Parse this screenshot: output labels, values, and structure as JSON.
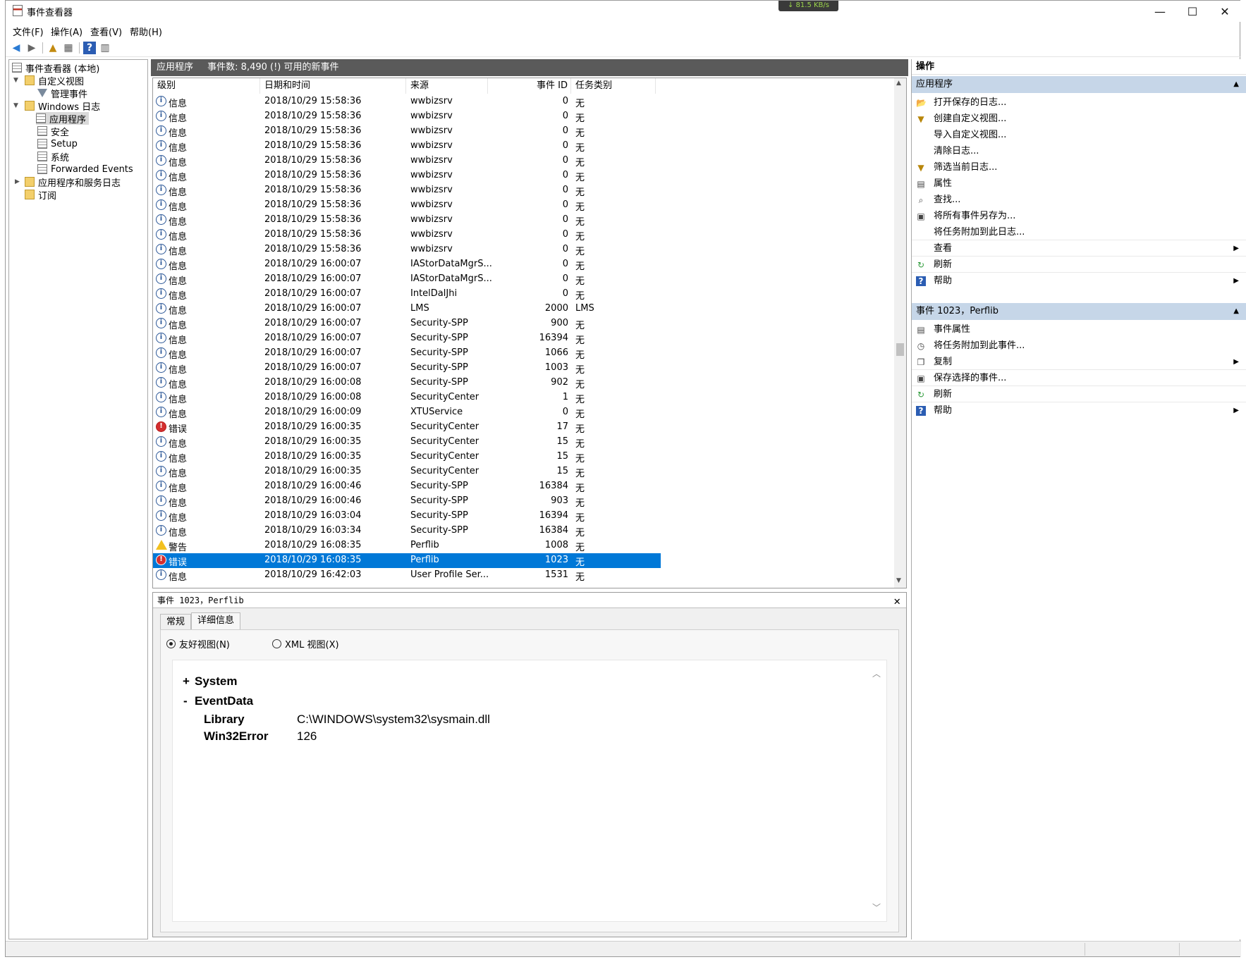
{
  "window": {
    "title": "事件查看器",
    "net_speed": "↓ 81.5 KB/s",
    "min": "—",
    "max": "☐",
    "close": "✕"
  },
  "menu": [
    "文件(F)",
    "操作(A)",
    "查看(V)",
    "帮助(H)"
  ],
  "tree": {
    "root": "事件查看器 (本地)",
    "custom_views": "自定义视图",
    "admin_events": "管理事件",
    "windows_logs": "Windows 日志",
    "application": "应用程序",
    "security": "安全",
    "setup": "Setup",
    "system": "系统",
    "forwarded": "Forwarded Events",
    "app_service_logs": "应用程序和服务日志",
    "subscriptions": "订阅"
  },
  "list": {
    "header_title": "应用程序",
    "header_count": "事件数: 8,490 (!) 可用的新事件",
    "columns": [
      "级别",
      "日期和时间",
      "来源",
      "事件 ID",
      "任务类别"
    ],
    "rows": [
      {
        "level": "信息",
        "kind": "info",
        "time": "2018/10/29 15:58:36",
        "source": "wwbizsrv",
        "id": "0",
        "task": "无"
      },
      {
        "level": "信息",
        "kind": "info",
        "time": "2018/10/29 15:58:36",
        "source": "wwbizsrv",
        "id": "0",
        "task": "无"
      },
      {
        "level": "信息",
        "kind": "info",
        "time": "2018/10/29 15:58:36",
        "source": "wwbizsrv",
        "id": "0",
        "task": "无"
      },
      {
        "level": "信息",
        "kind": "info",
        "time": "2018/10/29 15:58:36",
        "source": "wwbizsrv",
        "id": "0",
        "task": "无"
      },
      {
        "level": "信息",
        "kind": "info",
        "time": "2018/10/29 15:58:36",
        "source": "wwbizsrv",
        "id": "0",
        "task": "无"
      },
      {
        "level": "信息",
        "kind": "info",
        "time": "2018/10/29 15:58:36",
        "source": "wwbizsrv",
        "id": "0",
        "task": "无"
      },
      {
        "level": "信息",
        "kind": "info",
        "time": "2018/10/29 15:58:36",
        "source": "wwbizsrv",
        "id": "0",
        "task": "无"
      },
      {
        "level": "信息",
        "kind": "info",
        "time": "2018/10/29 15:58:36",
        "source": "wwbizsrv",
        "id": "0",
        "task": "无"
      },
      {
        "level": "信息",
        "kind": "info",
        "time": "2018/10/29 15:58:36",
        "source": "wwbizsrv",
        "id": "0",
        "task": "无"
      },
      {
        "level": "信息",
        "kind": "info",
        "time": "2018/10/29 15:58:36",
        "source": "wwbizsrv",
        "id": "0",
        "task": "无"
      },
      {
        "level": "信息",
        "kind": "info",
        "time": "2018/10/29 15:58:36",
        "source": "wwbizsrv",
        "id": "0",
        "task": "无"
      },
      {
        "level": "信息",
        "kind": "info",
        "time": "2018/10/29 16:00:07",
        "source": "IAStorDataMgrS...",
        "id": "0",
        "task": "无"
      },
      {
        "level": "信息",
        "kind": "info",
        "time": "2018/10/29 16:00:07",
        "source": "IAStorDataMgrS...",
        "id": "0",
        "task": "无"
      },
      {
        "level": "信息",
        "kind": "info",
        "time": "2018/10/29 16:00:07",
        "source": "IntelDalJhi",
        "id": "0",
        "task": "无"
      },
      {
        "level": "信息",
        "kind": "info",
        "time": "2018/10/29 16:00:07",
        "source": "LMS",
        "id": "2000",
        "task": "LMS"
      },
      {
        "level": "信息",
        "kind": "info",
        "time": "2018/10/29 16:00:07",
        "source": "Security-SPP",
        "id": "900",
        "task": "无"
      },
      {
        "level": "信息",
        "kind": "info",
        "time": "2018/10/29 16:00:07",
        "source": "Security-SPP",
        "id": "16394",
        "task": "无"
      },
      {
        "level": "信息",
        "kind": "info",
        "time": "2018/10/29 16:00:07",
        "source": "Security-SPP",
        "id": "1066",
        "task": "无"
      },
      {
        "level": "信息",
        "kind": "info",
        "time": "2018/10/29 16:00:07",
        "source": "Security-SPP",
        "id": "1003",
        "task": "无"
      },
      {
        "level": "信息",
        "kind": "info",
        "time": "2018/10/29 16:00:08",
        "source": "Security-SPP",
        "id": "902",
        "task": "无"
      },
      {
        "level": "信息",
        "kind": "info",
        "time": "2018/10/29 16:00:08",
        "source": "SecurityCenter",
        "id": "1",
        "task": "无"
      },
      {
        "level": "信息",
        "kind": "info",
        "time": "2018/10/29 16:00:09",
        "source": "XTUService",
        "id": "0",
        "task": "无"
      },
      {
        "level": "错误",
        "kind": "err",
        "time": "2018/10/29 16:00:35",
        "source": "SecurityCenter",
        "id": "17",
        "task": "无"
      },
      {
        "level": "信息",
        "kind": "info",
        "time": "2018/10/29 16:00:35",
        "source": "SecurityCenter",
        "id": "15",
        "task": "无"
      },
      {
        "level": "信息",
        "kind": "info",
        "time": "2018/10/29 16:00:35",
        "source": "SecurityCenter",
        "id": "15",
        "task": "无"
      },
      {
        "level": "信息",
        "kind": "info",
        "time": "2018/10/29 16:00:35",
        "source": "SecurityCenter",
        "id": "15",
        "task": "无"
      },
      {
        "level": "信息",
        "kind": "info",
        "time": "2018/10/29 16:00:46",
        "source": "Security-SPP",
        "id": "16384",
        "task": "无"
      },
      {
        "level": "信息",
        "kind": "info",
        "time": "2018/10/29 16:00:46",
        "source": "Security-SPP",
        "id": "903",
        "task": "无"
      },
      {
        "level": "信息",
        "kind": "info",
        "time": "2018/10/29 16:03:04",
        "source": "Security-SPP",
        "id": "16394",
        "task": "无"
      },
      {
        "level": "信息",
        "kind": "info",
        "time": "2018/10/29 16:03:34",
        "source": "Security-SPP",
        "id": "16384",
        "task": "无"
      },
      {
        "level": "警告",
        "kind": "warn",
        "time": "2018/10/29 16:08:35",
        "source": "Perflib",
        "id": "1008",
        "task": "无"
      },
      {
        "level": "错误",
        "kind": "err",
        "time": "2018/10/29 16:08:35",
        "source": "Perflib",
        "id": "1023",
        "task": "无",
        "selected": true
      },
      {
        "level": "信息",
        "kind": "info",
        "time": "2018/10/29 16:42:03",
        "source": "User Profile Ser...",
        "id": "1531",
        "task": "无"
      }
    ]
  },
  "detail": {
    "title": "事件 1023，Perflib",
    "close": "✕",
    "tabs": [
      "常规",
      "详细信息"
    ],
    "friendly": "友好视图(N)",
    "xml": "XML 视图(X)",
    "system": "System",
    "eventdata": "EventData",
    "plus": "+",
    "minus": "-",
    "fields": [
      {
        "key": "Library",
        "value": "C:\\WINDOWS\\system32\\sysmain.dll"
      },
      {
        "key": "Win32Error",
        "value": "126"
      }
    ]
  },
  "actions": {
    "header": "操作",
    "section1": "应用程序",
    "items1": [
      {
        "label": "打开保存的日志...",
        "icon": "folder-open-icon",
        "glyph": "📂"
      },
      {
        "label": "创建自定义视图...",
        "icon": "filter-add-icon",
        "glyph": "▼"
      },
      {
        "label": "导入自定义视图...",
        "icon": "",
        "glyph": ""
      },
      {
        "label": "清除日志...",
        "icon": "",
        "glyph": ""
      },
      {
        "label": "筛选当前日志...",
        "icon": "filter-icon",
        "glyph": "▼"
      },
      {
        "label": "属性",
        "icon": "properties-icon",
        "glyph": "▤"
      },
      {
        "label": "查找...",
        "icon": "binoculars-icon",
        "glyph": "⌕"
      },
      {
        "label": "将所有事件另存为...",
        "icon": "save-icon",
        "glyph": "▣"
      },
      {
        "label": "将任务附加到此日志...",
        "icon": "",
        "glyph": ""
      },
      {
        "label": "查看",
        "icon": "",
        "glyph": "",
        "submenu": true
      },
      {
        "label": "刷新",
        "icon": "refresh-icon",
        "glyph": "↻"
      },
      {
        "label": "帮助",
        "icon": "help-icon",
        "glyph": "?",
        "submenu": true
      }
    ],
    "section2": "事件 1023，Perflib",
    "items2": [
      {
        "label": "事件属性",
        "icon": "event-properties-icon",
        "glyph": "▤"
      },
      {
        "label": "将任务附加到此事件...",
        "icon": "task-clock-icon",
        "glyph": "◷"
      },
      {
        "label": "复制",
        "icon": "copy-icon",
        "glyph": "❐",
        "submenu": true
      },
      {
        "label": "保存选择的事件...",
        "icon": "save-icon",
        "glyph": "▣"
      },
      {
        "label": "刷新",
        "icon": "refresh-icon",
        "glyph": "↻"
      },
      {
        "label": "帮助",
        "icon": "help-icon",
        "glyph": "?",
        "submenu": true
      }
    ]
  }
}
